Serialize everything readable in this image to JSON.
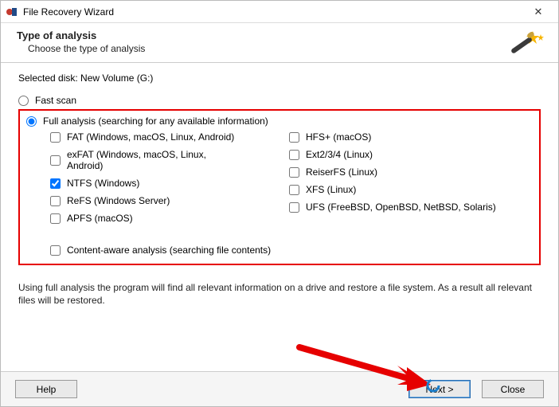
{
  "window": {
    "title": "File Recovery Wizard",
    "close_label": "✕"
  },
  "header": {
    "title": "Type of analysis",
    "subtitle": "Choose the type of analysis"
  },
  "selected_disk_label": "Selected disk: New Volume (G:)",
  "scan": {
    "fast_label": "Fast scan",
    "full_label": "Full analysis (searching for any available information)"
  },
  "filesystems_left": {
    "fat": "FAT (Windows, macOS, Linux, Android)",
    "exfat": "exFAT (Windows, macOS, Linux, Android)",
    "ntfs": "NTFS (Windows)",
    "refs": "ReFS (Windows Server)",
    "apfs": "APFS (macOS)"
  },
  "filesystems_right": {
    "hfs": "HFS+ (macOS)",
    "ext": "Ext2/3/4 (Linux)",
    "reiser": "ReiserFS (Linux)",
    "xfs": "XFS (Linux)",
    "ufs": "UFS (FreeBSD, OpenBSD, NetBSD, Solaris)"
  },
  "content_aware_label": "Content-aware analysis (searching file contents)",
  "info_text": "Using full analysis the program will find all relevant information on a drive and restore a file system. As a result all relevant files will be restored.",
  "buttons": {
    "help": "Help",
    "next": "Next >",
    "close": "Close"
  }
}
